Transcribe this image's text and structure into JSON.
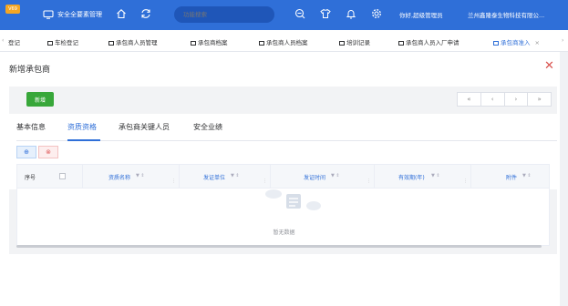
{
  "topbar": {
    "version_badge": "V69",
    "menu_title": "安全全要素管理",
    "search_placeholder": "功能搜索",
    "greeting": "你好,超级管理员",
    "company": "兰州鑫隆泰生物科技有限公...",
    "icons": [
      "monitor-icon",
      "home-icon",
      "refresh-icon",
      "zoom-icon",
      "shirt-icon",
      "bell-icon",
      "gear-icon"
    ]
  },
  "tabs": [
    {
      "label": "登记",
      "active": false
    },
    {
      "label": "车检登记",
      "active": false
    },
    {
      "label": "承包商人员管理",
      "active": false
    },
    {
      "label": "承包商档案",
      "active": false
    },
    {
      "label": "承包商人员档案",
      "active": false
    },
    {
      "label": "培训记录",
      "active": false
    },
    {
      "label": "承包商人员入厂申请",
      "active": false
    },
    {
      "label": "承包商准入",
      "active": true,
      "close": "×"
    }
  ],
  "panel": {
    "title": "新增承包商",
    "close_glyph": "✕",
    "add_button": "新增",
    "pager": [
      "«",
      "‹",
      "›",
      "»"
    ]
  },
  "subtabs": [
    {
      "label": "基本信息",
      "active": false
    },
    {
      "label": "资质资格",
      "active": true
    },
    {
      "label": "承包商关键人员",
      "active": false
    },
    {
      "label": "安全业绩",
      "active": false
    }
  ],
  "mini_buttons": {
    "add": "⊕",
    "remove": "⊗"
  },
  "table": {
    "columns": [
      "序号",
      "",
      "资质名称",
      "发证单位",
      "发证时间",
      "有效期(年)",
      "附件"
    ],
    "rows": [],
    "empty_text": "暂无数据"
  },
  "colors": {
    "brand": "#2f6fd8",
    "add_button": "#38a73a",
    "close": "#d9534f"
  }
}
